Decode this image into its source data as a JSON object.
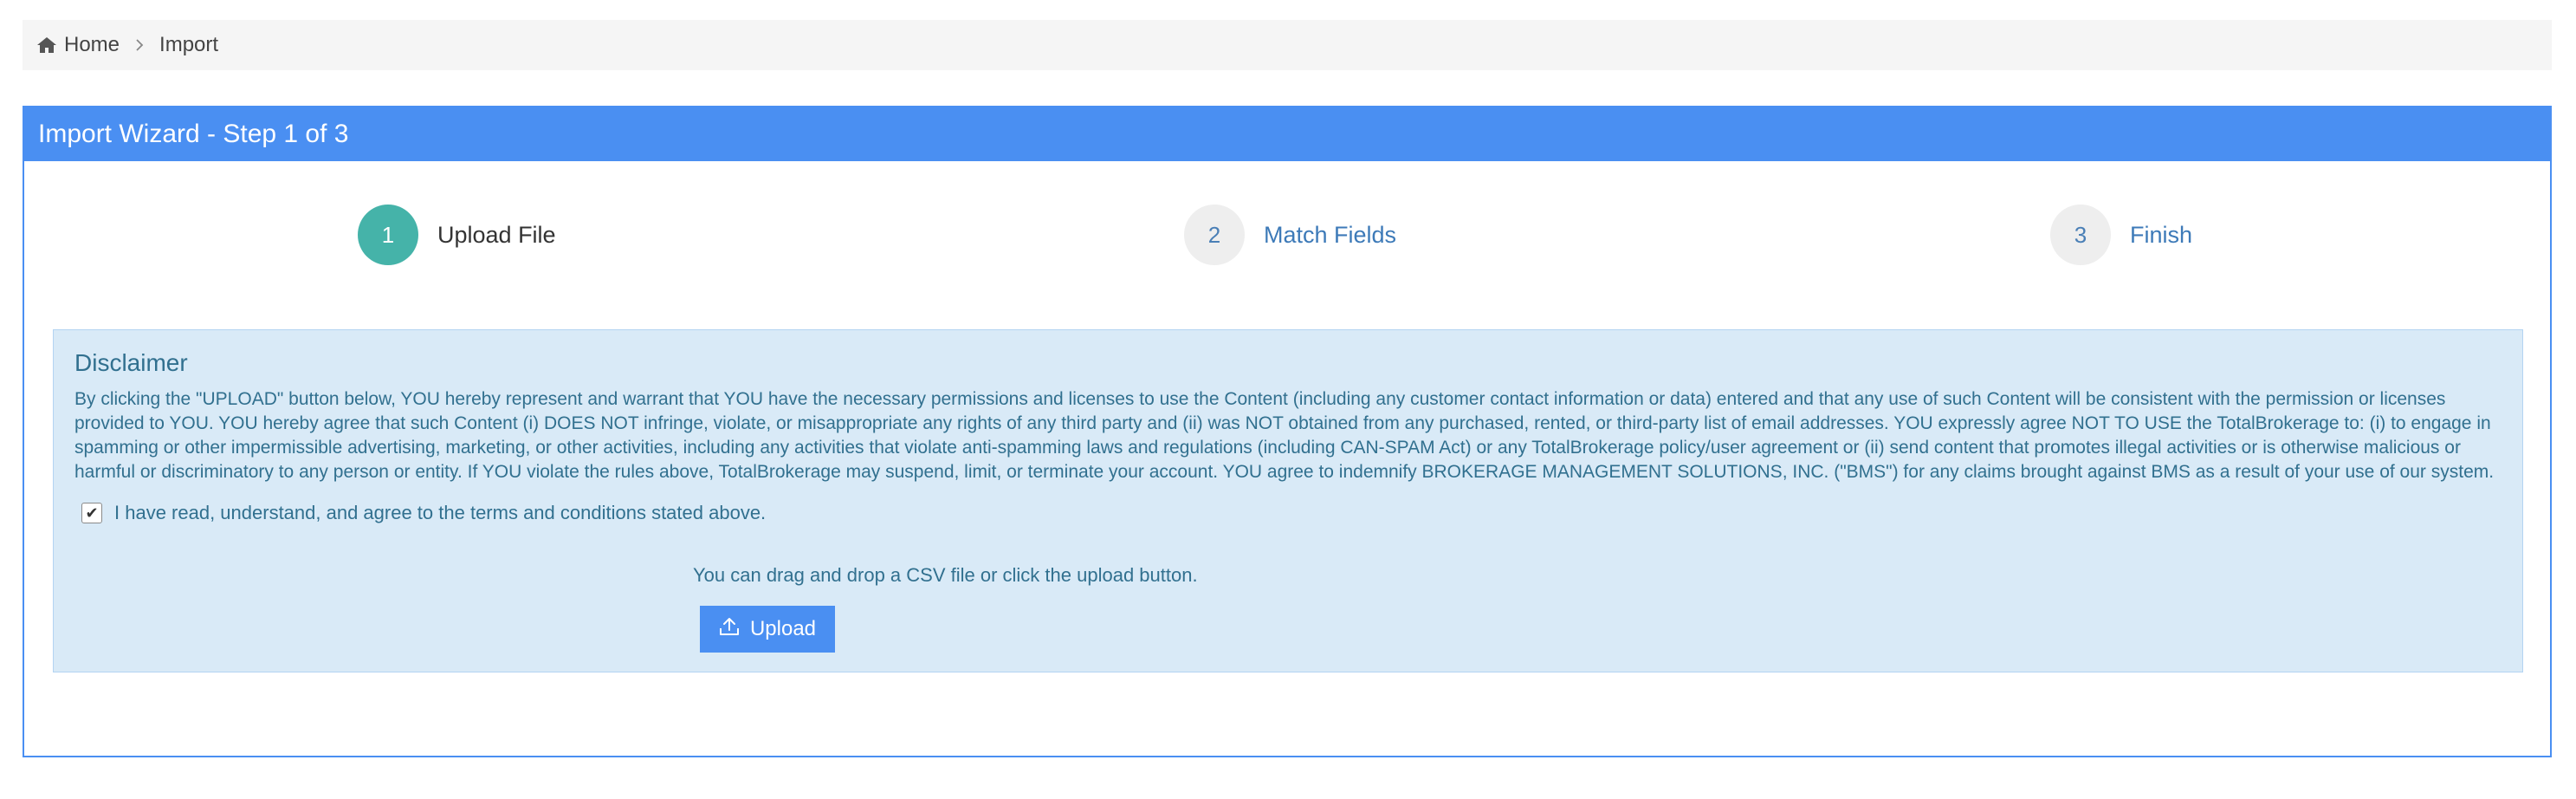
{
  "breadcrumb": {
    "home_icon": "home-icon",
    "home_label": "Home",
    "separator_icon": "chevron-right-icon",
    "current_label": "Import"
  },
  "panel": {
    "title": "Import Wizard - Step 1 of 3"
  },
  "steps": [
    {
      "number": "1",
      "label": "Upload File",
      "state": "active"
    },
    {
      "number": "2",
      "label": "Match Fields",
      "state": "inactive"
    },
    {
      "number": "3",
      "label": "Finish",
      "state": "inactive"
    }
  ],
  "disclaimer": {
    "title": "Disclaimer",
    "body": "By clicking the \"UPLOAD\" button below, YOU hereby represent and warrant that YOU have the necessary permissions and licenses to use the Content (including any customer contact information or data) entered and that any use of such Content will be consistent with the permission or licenses provided to YOU. YOU hereby agree that such Content (i) DOES NOT infringe, violate, or misappropriate any rights of any third party and (ii) was NOT obtained from any purchased, rented, or third-party list of email addresses. YOU expressly agree NOT TO USE the TotalBrokerage to: (i) to engage in spamming or other impermissible advertising, marketing, or other activities, including any activities that violate anti-spamming laws and regulations (including CAN-SPAM Act) or any TotalBrokerage policy/user agreement or (ii) send content that promotes illegal activities or is otherwise malicious or harmful or discriminatory to any person or entity. If YOU violate the rules above, TotalBrokerage may suspend, limit, or terminate your account. YOU agree to indemnify BROKERAGE MANAGEMENT SOLUTIONS, INC. (\"BMS\") for any claims brought against BMS as a result of your use of our system.",
    "agree_label": "I have read, understand, and agree to the terms and conditions stated above.",
    "agree_checked": true,
    "drag_hint": "You can drag and drop a CSV file or click the upload button.",
    "upload_label": "Upload",
    "upload_icon": "upload-icon"
  },
  "colors": {
    "accent": "#4a8ff2",
    "step_active": "#45b3a9",
    "disclaimer_bg": "#d9eaf7",
    "disclaimer_text": "#31708f"
  }
}
